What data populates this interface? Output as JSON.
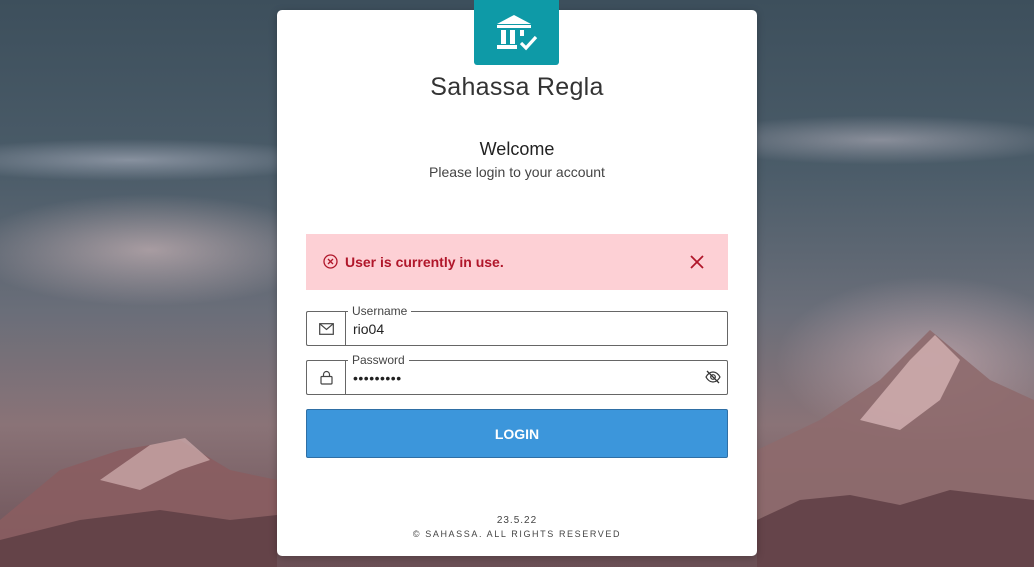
{
  "app": {
    "name": "Sahassa Regla",
    "logo_icon": "bank-check-icon",
    "brand_color": "#0e9aa7"
  },
  "welcome": {
    "title": "Welcome",
    "subtitle": "Please login to your account"
  },
  "alert": {
    "message": "User is currently in use.",
    "icon": "error-circle-x-icon",
    "close_icon": "close-icon",
    "background": "#fdd0d5",
    "color": "#b0162a"
  },
  "form": {
    "username": {
      "label": "Username",
      "value": "rio04",
      "icon": "mail-icon"
    },
    "password": {
      "label": "Password",
      "value": "•••••••••",
      "icon": "lock-icon",
      "toggle_icon": "eye-off-icon"
    },
    "login_label": "LOGIN",
    "login_color": "#3c96db"
  },
  "footer": {
    "version": "23.5.22",
    "copyright": "© SAHASSA. ALL RIGHTS RESERVED"
  }
}
